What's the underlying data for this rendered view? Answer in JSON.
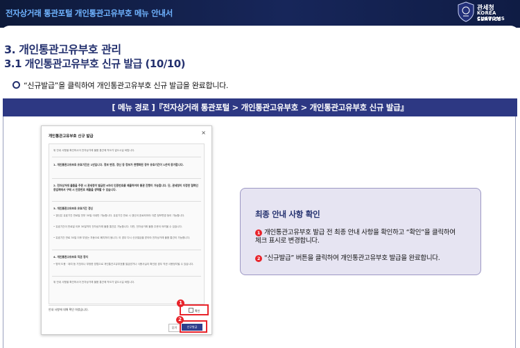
{
  "header": {
    "title": "전자상거래 통관포털 개인통관고유부호 메뉴 안내서",
    "logo": {
      "ko": "관세청",
      "en_line1": "KOREA CUSTOMS",
      "en_line2": "SERVICE"
    }
  },
  "section": {
    "heading": "3. 개인통관고유부호 관리",
    "subheading": "3.1 개인통관고유부호 신규 발급 (10/10)",
    "bullet": "“신규발급”을 클릭하여 개인통관고유부호 신규 발급을 완료합니다."
  },
  "menu_path": "[ 메뉴 경로 ]『전자상거래 통관포털 > 개인통관고유부호 > 개인통관고유부호 신규 발급』",
  "modal": {
    "title": "개인통관고유부호 신규 발급",
    "close": "×",
    "intro": "위 안내 사항을 확인하시어 전자상거래 물품 통관에 착오가 없으시길 바랍니다.",
    "item1": "1. 개인통관고유부호 유효기간은 1년입니다. 정보 변경, 갱신 등 정보가 현행화된 경우 유효기간이 1년씩 증가합니다.",
    "item2": "2. 전자상거래 물품을 주문 시 관세청이 발급한 6자리 인증번호를 제출하여야 통관 진행이 가능합니다. 단, 관세청이 지정한 협력인증업체에서 구매 시 인증번호 제출을 생략할 수 있습니다.",
    "item3_head": "3. 개인통관고유부호 유효기간 갱신",
    "item3_b1": "• 갱신은 유효기간 만료일 전부 30일 이내만 가능합니다. 유효기간 만료 시 갱신이 완료되어야 다른 정보변경 등이 가능합니다.",
    "item3_b2": "• 유효기간이 만료일 이후 30일까지 전자상거래 물품 통관은 가능합니다. 다만, 전자상거래 물품 주문이 어려울 수 있습니다.",
    "item3_b3": "• 유효기간 만료 30일 이후 부호는 자동으로 폐지처리 됩니다. 이 경우 다시 신규발급을 받아야 전자상거래 물품 통관이 가능합니다.",
    "item4_head": "4. 개인통관고유부호 직권 정지",
    "item4_b1": "• 명의 도용 · 대여 등 거짓이나 부정한 방법으로 개인통관고유부호를 발급받거나 사용사실이 확인된 경우 직권 사용정지될 수 있습니다.",
    "outro": "위 안내 사항을 확인하시어 전자상거래 물품 통관에 착오가 없으시길 바랍니다.",
    "confirm_text": "안내 사항에 대해 확인 하였습니다.",
    "confirm_check": "확인",
    "close_button": "닫기",
    "issue_button": "신규발급",
    "marker1": "1",
    "marker2": "2"
  },
  "info_box": {
    "title": "최종 안내 사항 확인",
    "step1_num": "1",
    "step1_line1": "개인통관고유부호 발급 전 최종 안내 사항을 확인하고 “확인”을 클릭하여",
    "step1_line2": "체크 표시로 변경합니다.",
    "step2_num": "2",
    "step2": "“신규발급” 버튼을 클릭하여 개인통관고유부호 발급을 완료합니다."
  },
  "colors": {
    "brand_navy": "#2d3883",
    "accent_red": "#e8232a",
    "info_bg": "#e6e4f2"
  }
}
